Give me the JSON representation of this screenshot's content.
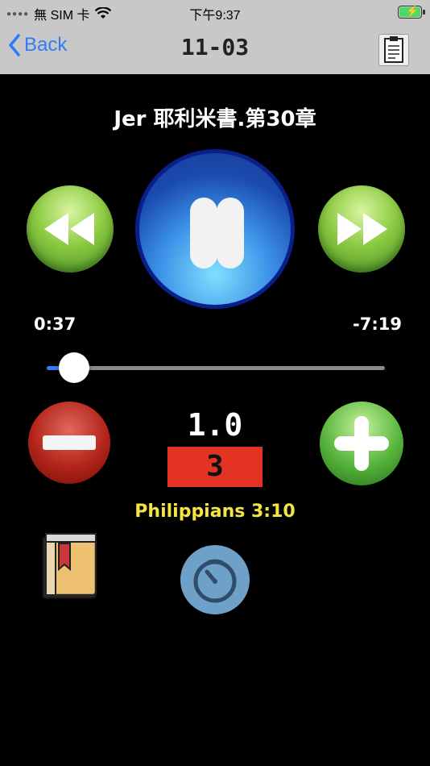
{
  "status": {
    "carrier": "無 SIM 卡",
    "time": "下午9:37"
  },
  "nav": {
    "back_label": "Back",
    "title": "11-03"
  },
  "player": {
    "chapter": "Jer 耶利米書.第30章",
    "elapsed": "0:37",
    "remaining": "-7:19",
    "progress": 0.08,
    "speed": "1.0",
    "counter": "3",
    "verse": "Philippians 3:10"
  },
  "colors": {
    "nav_bg": "#c8c8c8",
    "accent_blue": "#2f7cf6",
    "counter_red": "#e23324",
    "verse_yellow": "#f5e542"
  },
  "icons": {
    "clipboard": "clipboard-icon",
    "rewind": "rewind-icon",
    "pause": "pause-icon",
    "forward": "fast-forward-icon",
    "minus": "minus-icon",
    "plus": "plus-icon",
    "book": "bookmark-book-icon",
    "timer": "timer-icon"
  }
}
